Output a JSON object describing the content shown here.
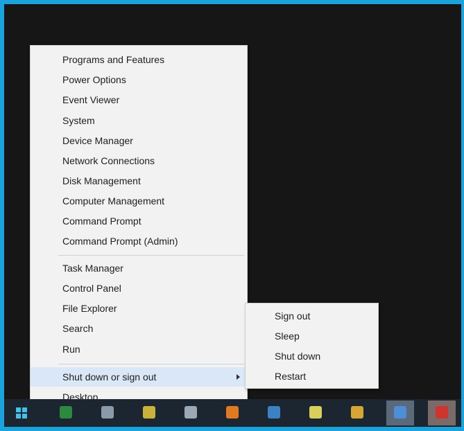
{
  "menu": {
    "items": [
      {
        "label": "Programs and Features"
      },
      {
        "label": "Power Options"
      },
      {
        "label": "Event Viewer"
      },
      {
        "label": "System"
      },
      {
        "label": "Device Manager"
      },
      {
        "label": "Network Connections"
      },
      {
        "label": "Disk Management"
      },
      {
        "label": "Computer Management"
      },
      {
        "label": "Command Prompt"
      },
      {
        "label": "Command Prompt (Admin)"
      },
      {
        "label": "Task Manager"
      },
      {
        "label": "Control Panel"
      },
      {
        "label": "File Explorer"
      },
      {
        "label": "Search"
      },
      {
        "label": "Run"
      },
      {
        "label": "Shut down or sign out"
      },
      {
        "label": "Desktop"
      }
    ]
  },
  "submenu": {
    "items": [
      {
        "label": "Sign out"
      },
      {
        "label": "Sleep"
      },
      {
        "label": "Shut down"
      },
      {
        "label": "Restart"
      }
    ]
  },
  "taskbar": {
    "icons": [
      "start-windows-logo-icon",
      "browser-icon",
      "file-explorer-icon",
      "app-icon",
      "media-player-icon",
      "firefox-icon",
      "camera-icon",
      "paint-icon",
      "tool-icon",
      "window-icon",
      "acrobat-icon"
    ],
    "colors": {
      "accent": "#1aa3dc",
      "highlight": "#d9e7f7"
    }
  }
}
